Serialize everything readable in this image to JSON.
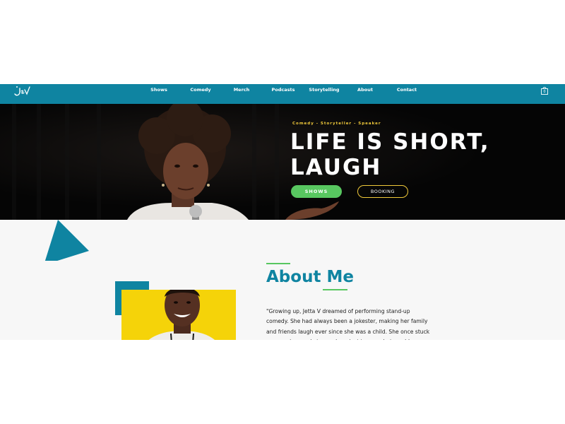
{
  "nav": {
    "items": [
      {
        "label": "Shows"
      },
      {
        "label": "Comedy"
      },
      {
        "label": "Merch"
      },
      {
        "label": "Podcasts"
      },
      {
        "label": "Storytelling"
      },
      {
        "label": "About"
      },
      {
        "label": "Contact"
      }
    ],
    "cart_count": "0",
    "logo_icon": "jetta-v-logo",
    "cart_icon": "shopping-bag-icon"
  },
  "hero": {
    "subtitle": "Comedy - Storyteller - Speaker",
    "title_line1": "LIFE IS SHORT,",
    "title_line2": "LAUGH",
    "shows_label": "SHOWS",
    "booking_label": "BOOKING"
  },
  "about": {
    "title": "About Me",
    "text": "\"Growing up, Jetta V dreamed of performing stand-up comedy. She had always been a jokester, making her family and friends laugh ever since she was a child. She once stuck a penny in a socket on a dare, just to see what would happen, earning the"
  },
  "colors": {
    "teal": "#0f84a1",
    "green": "#58c760",
    "yellow": "#f5d309",
    "gold": "#f0c93a",
    "hero_bg": "#060606"
  }
}
